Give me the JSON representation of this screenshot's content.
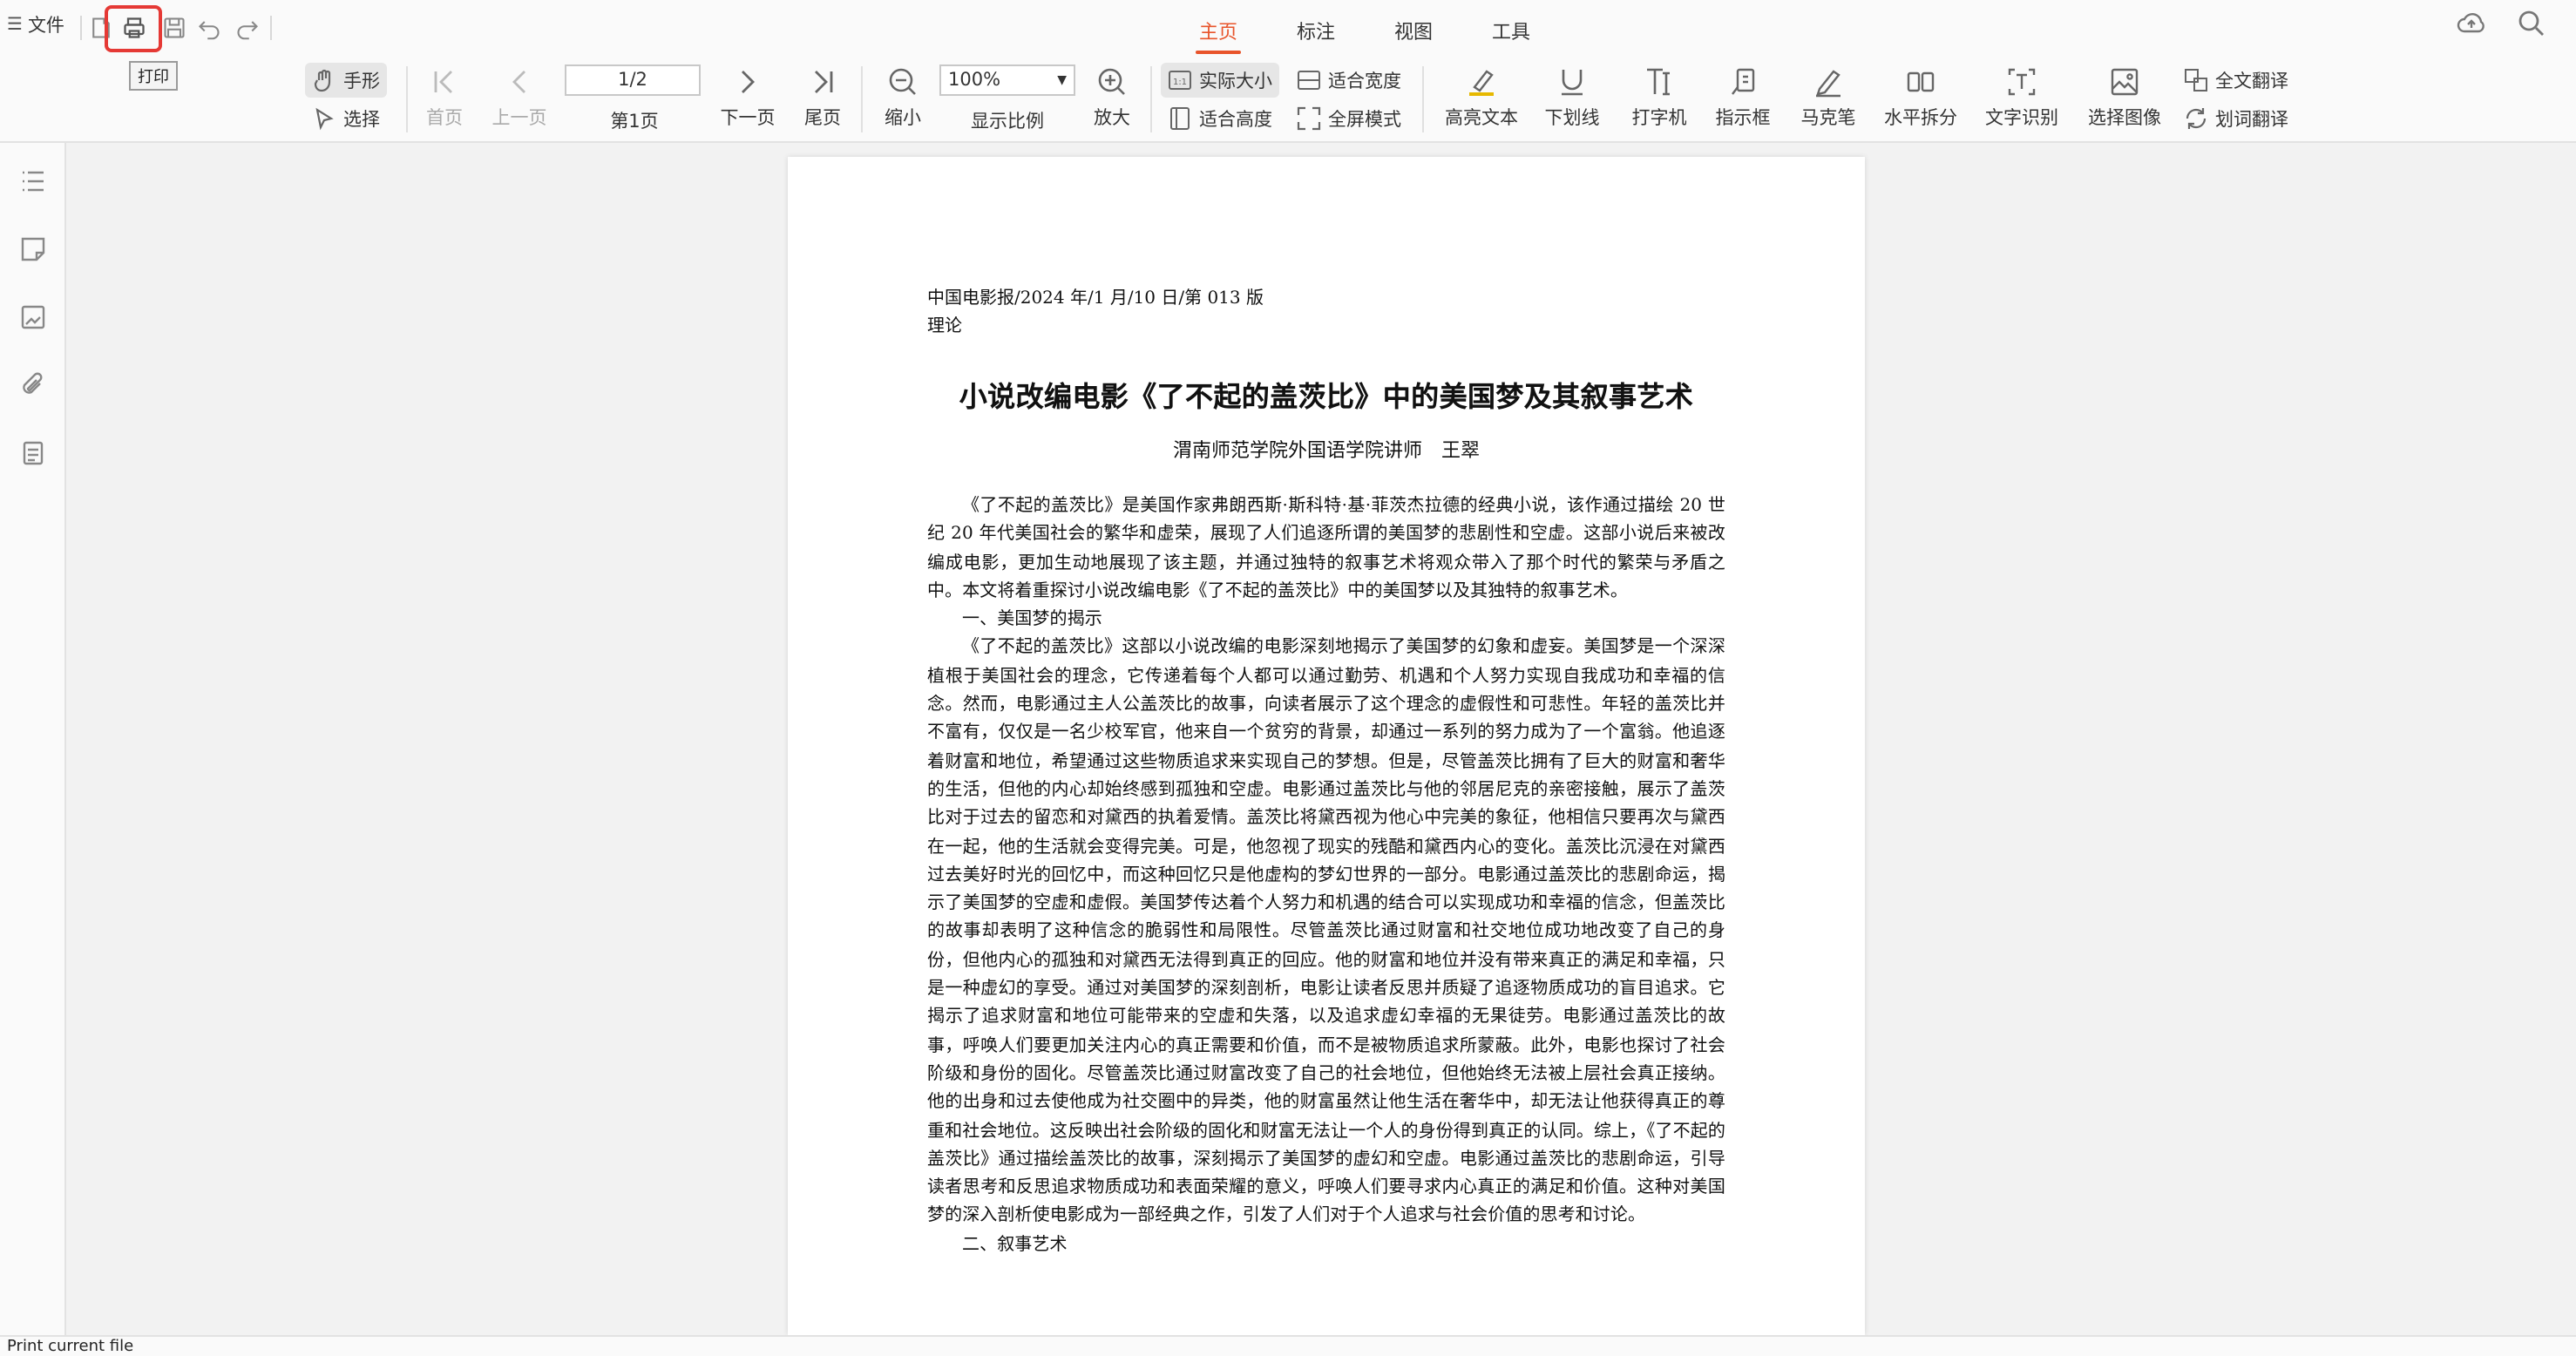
{
  "quick_access": {
    "file_label": "文件",
    "print_tooltip": "打印"
  },
  "menu_tabs": [
    {
      "label": "主页",
      "active": true
    },
    {
      "label": "标注",
      "active": false
    },
    {
      "label": "视图",
      "active": false
    },
    {
      "label": "工具",
      "active": false
    }
  ],
  "toolbar": {
    "hand": "手形",
    "select": "选择",
    "first_page": "首页",
    "prev_page": "上一页",
    "page_input": "1/2",
    "page_label": "第1页",
    "next_page": "下一页",
    "last_page": "尾页",
    "zoom_out": "缩小",
    "zoom_value": "100%",
    "zoom_label": "显示比例",
    "zoom_in": "放大",
    "actual_size": "实际大小",
    "fit_width": "适合宽度",
    "fit_height": "适合高度",
    "fullscreen": "全屏模式",
    "highlight_text": "高亮文本",
    "underline": "下划线",
    "typewriter": "打字机",
    "pointer_box": "指示框",
    "marker": "马克笔",
    "split_horizontal": "水平拆分",
    "ocr": "文字识别",
    "select_image": "选择图像",
    "full_translate": "全文翻译",
    "word_translate": "划词翻译"
  },
  "document": {
    "meta_line1": "中国电影报/2024 年/1 月/10 日/第 013 版",
    "meta_line2": "理论",
    "title": "小说改编电影《了不起的盖茨比》中的美国梦及其叙事艺术",
    "author": "渭南师范学院外国语学院讲师　王翠",
    "para1": "《了不起的盖茨比》是美国作家弗朗西斯·斯科特·基·菲茨杰拉德的经典小说，该作通过描绘 20 世纪 20 年代美国社会的繁华和虚荣，展现了人们追逐所谓的美国梦的悲剧性和空虚。这部小说后来被改编成电影，更加生动地展现了该主题，并通过独特的叙事艺术将观众带入了那个时代的繁荣与矛盾之中。本文将着重探讨小说改编电影《了不起的盖茨比》中的美国梦以及其独特的叙事艺术。",
    "heading1": "一、美国梦的揭示",
    "para2": "《了不起的盖茨比》这部以小说改编的电影深刻地揭示了美国梦的幻象和虚妄。美国梦是一个深深植根于美国社会的理念，它传递着每个人都可以通过勤劳、机遇和个人努力实现自我成功和幸福的信念。然而，电影通过主人公盖茨比的故事，向读者展示了这个理念的虚假性和可悲性。年轻的盖茨比并不富有，仅仅是一名少校军官，他来自一个贫穷的背景，却通过一系列的努力成为了一个富翁。他追逐着财富和地位，希望通过这些物质追求来实现自己的梦想。但是，尽管盖茨比拥有了巨大的财富和奢华的生活，但他的内心却始终感到孤独和空虚。电影通过盖茨比与他的邻居尼克的亲密接触，展示了盖茨比对于过去的留恋和对黛西的执着爱情。盖茨比将黛西视为他心中完美的象征，他相信只要再次与黛西在一起，他的生活就会变得完美。可是，他忽视了现实的残酷和黛西内心的变化。盖茨比沉浸在对黛西过去美好时光的回忆中，而这种回忆只是他虚构的梦幻世界的一部分。电影通过盖茨比的悲剧命运，揭示了美国梦的空虚和虚假。美国梦传达着个人努力和机遇的结合可以实现成功和幸福的信念，但盖茨比的故事却表明了这种信念的脆弱性和局限性。尽管盖茨比通过财富和社交地位成功地改变了自己的身份，但他内心的孤独和对黛西无法得到真正的回应。他的财富和地位并没有带来真正的满足和幸福，只是一种虚幻的享受。通过对美国梦的深刻剖析，电影让读者反思并质疑了追逐物质成功的盲目追求。它揭示了追求财富和地位可能带来的空虚和失落，以及追求虚幻幸福的无果徒劳。电影通过盖茨比的故事，呼唤人们要更加关注内心的真正需要和价值，而不是被物质追求所蒙蔽。此外，电影也探讨了社会阶级和身份的固化。尽管盖茨比通过财富改变了自己的社会地位，但他始终无法被上层社会真正接纳。他的出身和过去使他成为社交圈中的异类，他的财富虽然让他生活在奢华中，却无法让他获得真正的尊重和社会地位。这反映出社会阶级的固化和财富无法让一个人的身份得到真正的认同。综上，《了不起的盖茨比》通过描绘盖茨比的故事，深刻揭示了美国梦的虚幻和空虚。电影通过盖茨比的悲剧命运，引导读者思考和反思追求物质成功和表面荣耀的意义，呼唤人们要寻求内心真正的满足和价值。这种对美国梦的深入剖析使电影成为一部经典之作，引发了人们对于个人追求与社会价值的思考和讨论。",
    "heading2": "二、叙事艺术"
  },
  "status_bar": {
    "text": "Print current file"
  },
  "colors": {
    "accent": "#e8542b",
    "highlight_border": "#e53935"
  }
}
